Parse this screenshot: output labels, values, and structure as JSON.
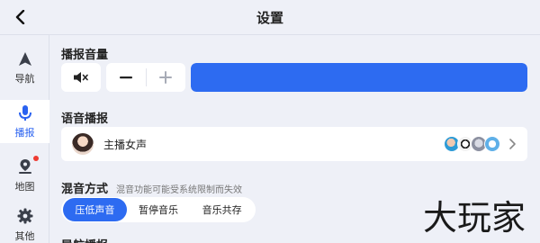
{
  "header": {
    "title": "设置",
    "back_icon": "chevron-left-icon"
  },
  "sidebar": {
    "items": [
      {
        "label": "导航",
        "icon": "navigation-arrow-icon",
        "active": false,
        "badge": false
      },
      {
        "label": "播报",
        "icon": "microphone-icon",
        "active": true,
        "badge": false
      },
      {
        "label": "地图",
        "icon": "map-pin-icon",
        "active": false,
        "badge": true
      },
      {
        "label": "其他",
        "icon": "gear-icon",
        "active": false,
        "badge": false
      }
    ]
  },
  "volume": {
    "title": "播报音量",
    "mute_icon": "speaker-mute-icon",
    "decrease_icon": "minus-icon",
    "increase_icon": "plus-icon",
    "level": 1.0
  },
  "voice": {
    "title": "语音播报",
    "selected_name": "主播女声",
    "avatar_icon": "female-voice-avatar",
    "more_icon": "chevron-right-icon"
  },
  "mix": {
    "title": "混音方式",
    "hint": "混音功能可能受系统限制而失效",
    "options": [
      "压低声音",
      "暂停音乐",
      "音乐共存"
    ],
    "selected_index": 0
  },
  "next_section": {
    "title": "导航播报"
  },
  "watermark": {
    "text": "大玩家"
  },
  "colors": {
    "accent": "#2d6bf1",
    "background": "#eef0f7",
    "card": "#ffffff",
    "badge": "#ee3b32"
  }
}
